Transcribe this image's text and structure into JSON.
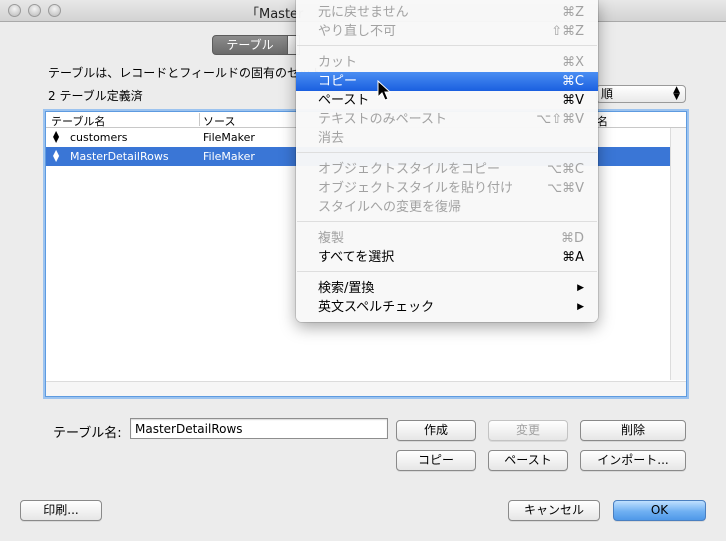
{
  "window": {
    "title": "「Master"
  },
  "tabs": {
    "active_label": "テーブル"
  },
  "description": "テーブルは、レコードとフィールドの固有のセット",
  "count_label": "2 テーブル定義済",
  "view_select": {
    "value": "順"
  },
  "table": {
    "headers": [
      "テーブル名",
      "ソース",
      "名"
    ],
    "rows": [
      {
        "name": "customers",
        "source": "FileMaker",
        "selected": false
      },
      {
        "name": "MasterDetailRows",
        "source": "FileMaker",
        "selected": true
      }
    ]
  },
  "form": {
    "name_label": "テーブル名:",
    "name_value": "MasterDetailRows",
    "create_label": "作成",
    "change_label": "変更",
    "delete_label": "削除",
    "copy_label": "コピー",
    "paste_label": "ペースト",
    "import_label": "インポート..."
  },
  "footer": {
    "print_label": "印刷...",
    "cancel_label": "キャンセル",
    "ok_label": "OK"
  },
  "colors": {
    "accent": "#3a76d6",
    "menu_highlight": "#1a5fe0"
  },
  "edit_menu": {
    "items": [
      {
        "label": "元に戻せません",
        "shortcut": "⌘Z",
        "enabled": false
      },
      {
        "label": "やり直し不可",
        "shortcut": "⇧⌘Z",
        "enabled": false
      },
      {
        "label": "カット",
        "shortcut": "⌘X",
        "enabled": false
      },
      {
        "label": "コピー",
        "shortcut": "⌘C",
        "enabled": true,
        "highlighted": true
      },
      {
        "label": "ペースト",
        "shortcut": "⌘V",
        "enabled": true
      },
      {
        "label": "テキストのみペースト",
        "shortcut": "⌥⇧⌘V",
        "enabled": false
      },
      {
        "label": "消去",
        "shortcut": "",
        "enabled": false
      },
      {
        "label": "オブジェクトスタイルをコピー",
        "shortcut": "⌥⌘C",
        "enabled": false
      },
      {
        "label": "オブジェクトスタイルを貼り付け",
        "shortcut": "⌥⌘V",
        "enabled": false
      },
      {
        "label": "スタイルへの変更を復帰",
        "shortcut": "",
        "enabled": false
      },
      {
        "label": "複製",
        "shortcut": "⌘D",
        "enabled": false
      },
      {
        "label": "すべてを選択",
        "shortcut": "⌘A",
        "enabled": true
      },
      {
        "label": "検索/置換",
        "shortcut": "▶",
        "enabled": true
      },
      {
        "label": "英文スペルチェック",
        "shortcut": "▶",
        "enabled": true
      }
    ]
  }
}
